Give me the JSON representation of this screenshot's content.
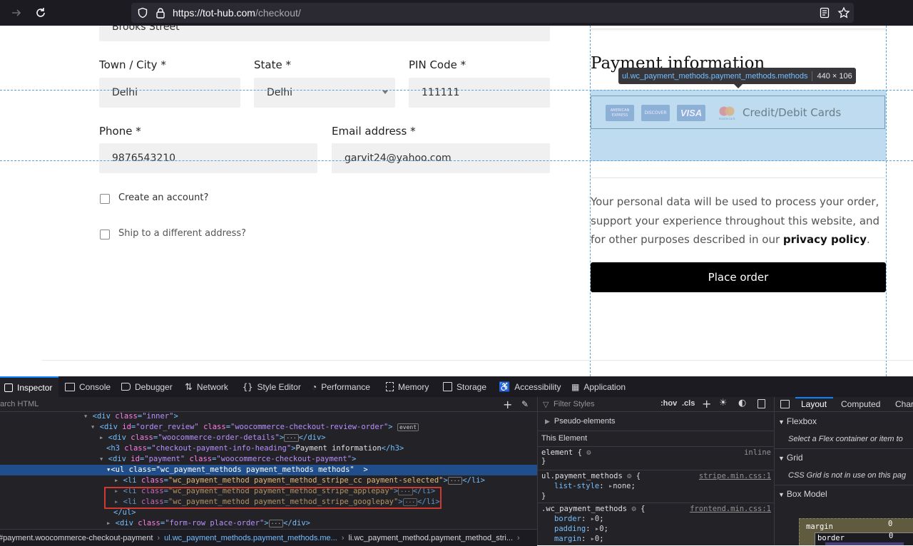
{
  "browser": {
    "url_host": "https://tot-hub.com",
    "url_path": "/checkout/"
  },
  "form": {
    "street_value": "Brooks Street",
    "town_label": "Town / City *",
    "town_value": "Delhi",
    "state_label": "State *",
    "state_value": "Delhi",
    "pin_label": "PIN Code *",
    "pin_value": "111111",
    "phone_label": "Phone *",
    "phone_value": "9876543210",
    "email_label": "Email address *",
    "email_value": "garvit24@yahoo.com",
    "create_account_label": "Create an account?",
    "ship_different_label": "Ship to a different address?"
  },
  "payment": {
    "heading": "Payment information",
    "tooltip_selector": "ul.wc_payment_methods.payment_methods.methods",
    "tooltip_size": "440 × 106",
    "method_label": "Credit/Debit Cards",
    "card_brands": [
      "AMERICAN EXPRESS",
      "DISCOVER",
      "VISA",
      "mastercard"
    ],
    "privacy_text": "Your personal data will be used to process your order, support your experience throughout this website, and for other purposes described in our",
    "privacy_link": "privacy policy",
    "privacy_end": ".",
    "place_order": "Place order"
  },
  "devtools": {
    "tabs": [
      "Inspector",
      "Console",
      "Debugger",
      "Network",
      "Style Editor",
      "Performance",
      "Memory",
      "Storage",
      "Accessibility",
      "Application"
    ],
    "search_placeholder": "arch HTML",
    "filter_placeholder": "Filter Styles",
    "hov": ":hov",
    "cls": ".cls",
    "layout_tabs": [
      "Layout",
      "Computed",
      "Char"
    ],
    "flexbox_title": "Flexbox",
    "flexbox_msg": "Select a Flex container or item to",
    "grid_title": "Grid",
    "grid_msg": "CSS Grid is not in use on this pag",
    "boxmodel_title": "Box Model",
    "margin_label": "margin",
    "border_label": "border",
    "margin_value": "0",
    "border_value": "0",
    "pseudo_elements": "Pseudo-elements",
    "this_element": "This Element",
    "rule1_selector": "element {",
    "rule1_close": "}",
    "rule1_source": "inline",
    "rule2_selector": "ul.payment_methods",
    "rule2_source": "stripe.min.css:1",
    "rule2_prop": "list-style",
    "rule2_val": "none",
    "rule3_selector": ".wc_payment_methods",
    "rule3_source": "frontend.min.css:1",
    "rule3_props": [
      {
        "prop": "border",
        "val": "0"
      },
      {
        "prop": "padding",
        "val": "0"
      },
      {
        "prop": "margin",
        "val": "0"
      }
    ],
    "breadcrumbs": [
      "#payment.woocommerce-checkout-payment",
      "ul.wc_payment_methods.payment_methods.me...",
      "li.wc_payment_method.payment_method_stri..."
    ],
    "html_lines": {
      "l1_tag": "<div ",
      "l1_attr": "class",
      "l1_val": "\"inner\"",
      "l2_attr1": "id",
      "l2_val1": "\"order_review\"",
      "l2_attr2": "class",
      "l2_val2": "\"woocommerce-checkout-review-order\"",
      "l2_badge": "event",
      "l3_val": "\"woocommerce-order-details\"",
      "l4_tag_open": "<h3 ",
      "l4_val": "\"checkout-payment-info-heading\"",
      "l4_text": "Payment information",
      "l4_close": "</h3>",
      "l5_val1": "\"payment\"",
      "l5_val2": "\"woocommerce-checkout-payment\"",
      "l6_val": "\"wc_payment_methods payment_methods methods\"",
      "l7_val": "\"wc_payment_method payment_method_stripe_cc payment-selected\"",
      "l8_val": "\"wc_payment_method payment_method_stripe_applepay\"",
      "l9_val": "\"wc_payment_method payment_method_stripe_googlepay\"",
      "l10_close": "</ul>",
      "l11_val": "\"form-row place-order\""
    }
  }
}
